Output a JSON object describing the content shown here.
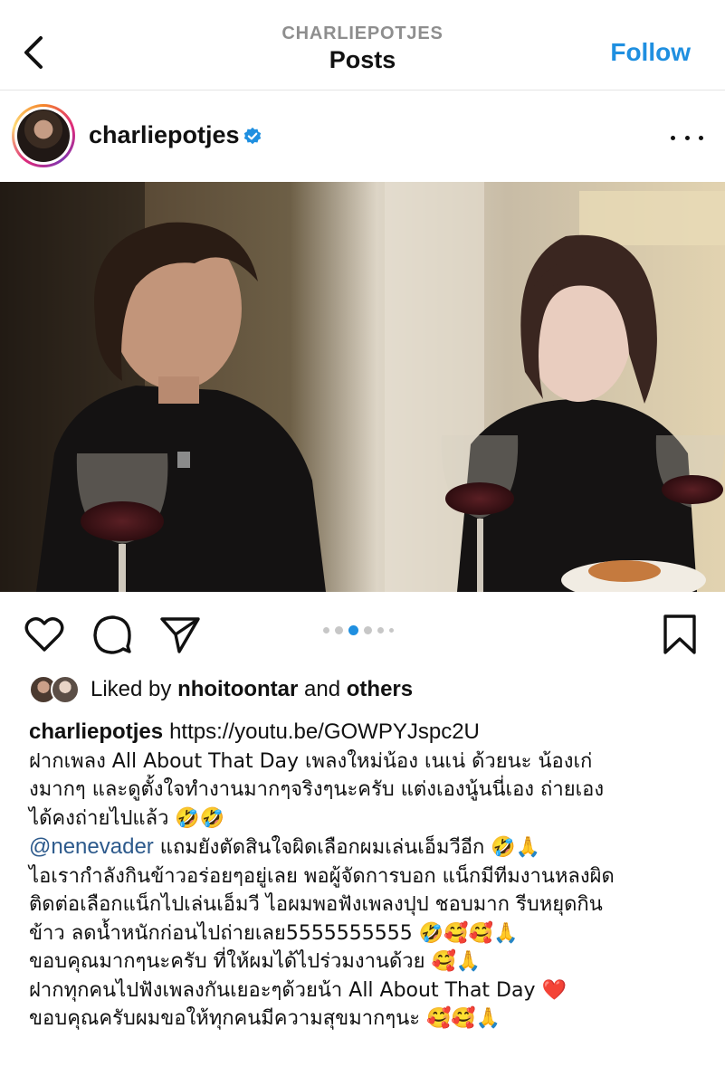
{
  "header": {
    "account_handle": "CHARLIEPOTJES",
    "title": "Posts",
    "follow_label": "Follow"
  },
  "post": {
    "username": "charliepotjes",
    "verified": true,
    "likes": {
      "prefix": "Liked by ",
      "user": "nhoitoontar",
      "middle": " and ",
      "suffix": "others"
    },
    "carousel": {
      "total": 6,
      "active_index": 2
    },
    "caption": {
      "username": "charliepotjes",
      "link": "https://youtu.be/GOWPYJspc2U",
      "lines": [
        "ฝากเพลง All About That Day เพลงใหม่น้อง เนเน่ ด้วยนะ น้องเก่",
        "งมากๆ และดูตั้งใจทำงานมากๆจริงๆนะครับ แต่งเองนู้นนี่เอง ถ่ายเอง",
        "ได้คงถ่ายไปแล้ว 🤣🤣"
      ],
      "mention": "@nenevader",
      "mention_text": "  แถมยังตัดสินใจผิดเลือกผมเล่นเอ็มวีอีก 🤣🙏",
      "more_lines": [
        "ไอเรากำลังกินข้าวอร่อยๆอยู่เลย พอผู้จัดการบอก แน็กมีทีมงานหลงผิด",
        "ติดต่อเลือกแน็กไปเล่นเอ็มวี ไอผมพอฟังเพลงปุป ชอบมาก รีบหยุดกิน",
        "ข้าว ลดน้ำหนักก่อนไปถ่ายเลย5555555555 🤣🥰🥰🙏",
        "ขอบคุณมากๆนะครับ ที่ให้ผมได้ไปร่วมงานด้วย 🥰🙏",
        "ฝากทุกคนไปฟังเพลงกันเยอะๆด้วยน้า All About That Day ❤️",
        "ขอบคุณครับผมขอให้ทุกคนมีความสุขมากๆนะ 🥰🥰🙏"
      ]
    }
  },
  "icons": {
    "back": "chevron-left-icon",
    "verified": "verified-badge-icon",
    "more": "more-horizontal-icon",
    "like": "heart-icon",
    "comment": "comment-icon",
    "share": "paper-plane-icon",
    "save": "bookmark-icon"
  },
  "colors": {
    "follow": "#1f8fe0",
    "verified": "#1f8fe0",
    "mention": "#2d5a8c",
    "carousel_active": "#1f8fe0"
  }
}
